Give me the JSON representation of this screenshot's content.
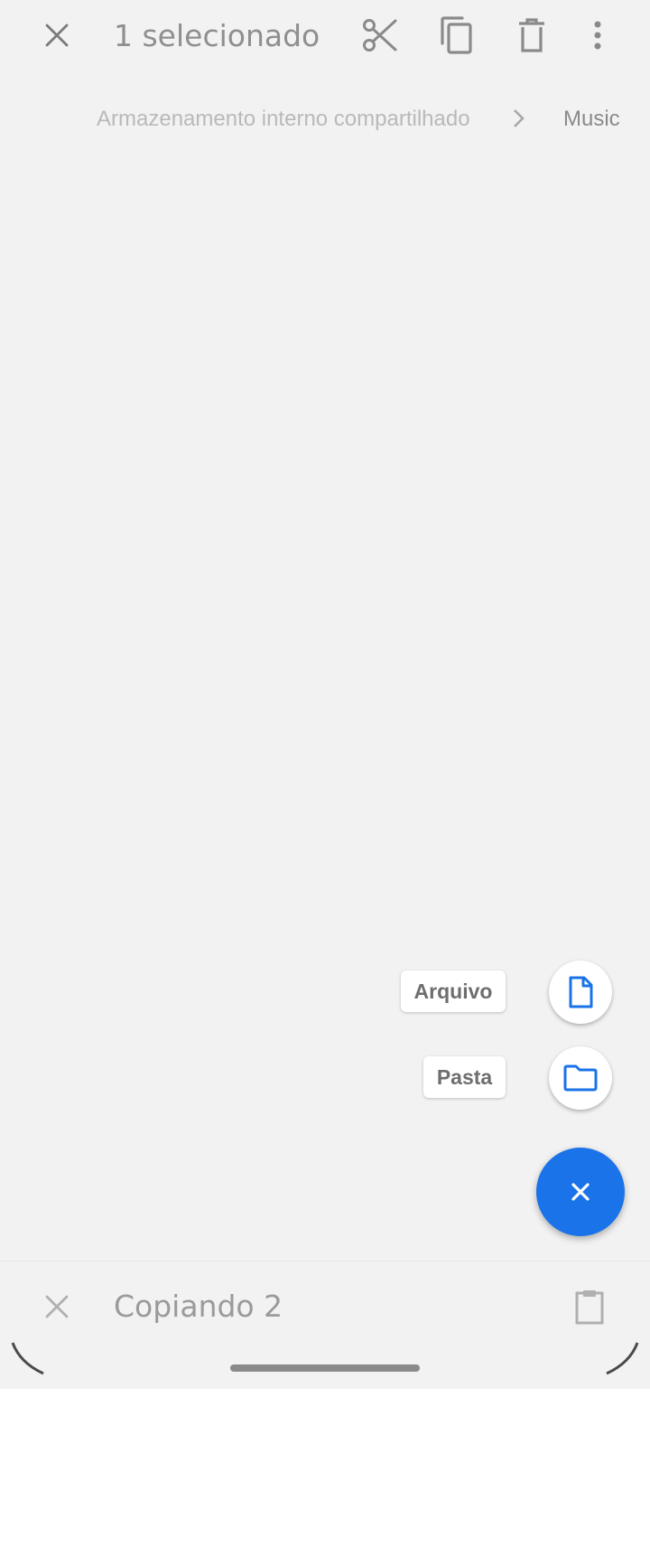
{
  "selection_bar": {
    "close_icon": "close-icon",
    "title": "1 selecionado",
    "actions": [
      {
        "name": "cut-icon",
        "label": ""
      },
      {
        "name": "copy-icon",
        "label": ""
      },
      {
        "name": "delete-icon",
        "label": ""
      },
      {
        "name": "more-vert-icon",
        "label": ""
      }
    ]
  },
  "breadcrumb": {
    "root": "Armazenamento interno compartilhado",
    "separator_icon": "chevron-right-icon",
    "current": "Music"
  },
  "speed_dial": {
    "items": [
      {
        "label": "Arquivo",
        "icon": "file-icon"
      },
      {
        "label": "Pasta",
        "icon": "folder-icon"
      }
    ],
    "main_icon": "close-icon",
    "accent_color": "#1a73e8"
  },
  "copy_bar": {
    "close_icon": "close-icon",
    "title": "Copiando 2",
    "paste_icon": "clipboard-icon"
  }
}
